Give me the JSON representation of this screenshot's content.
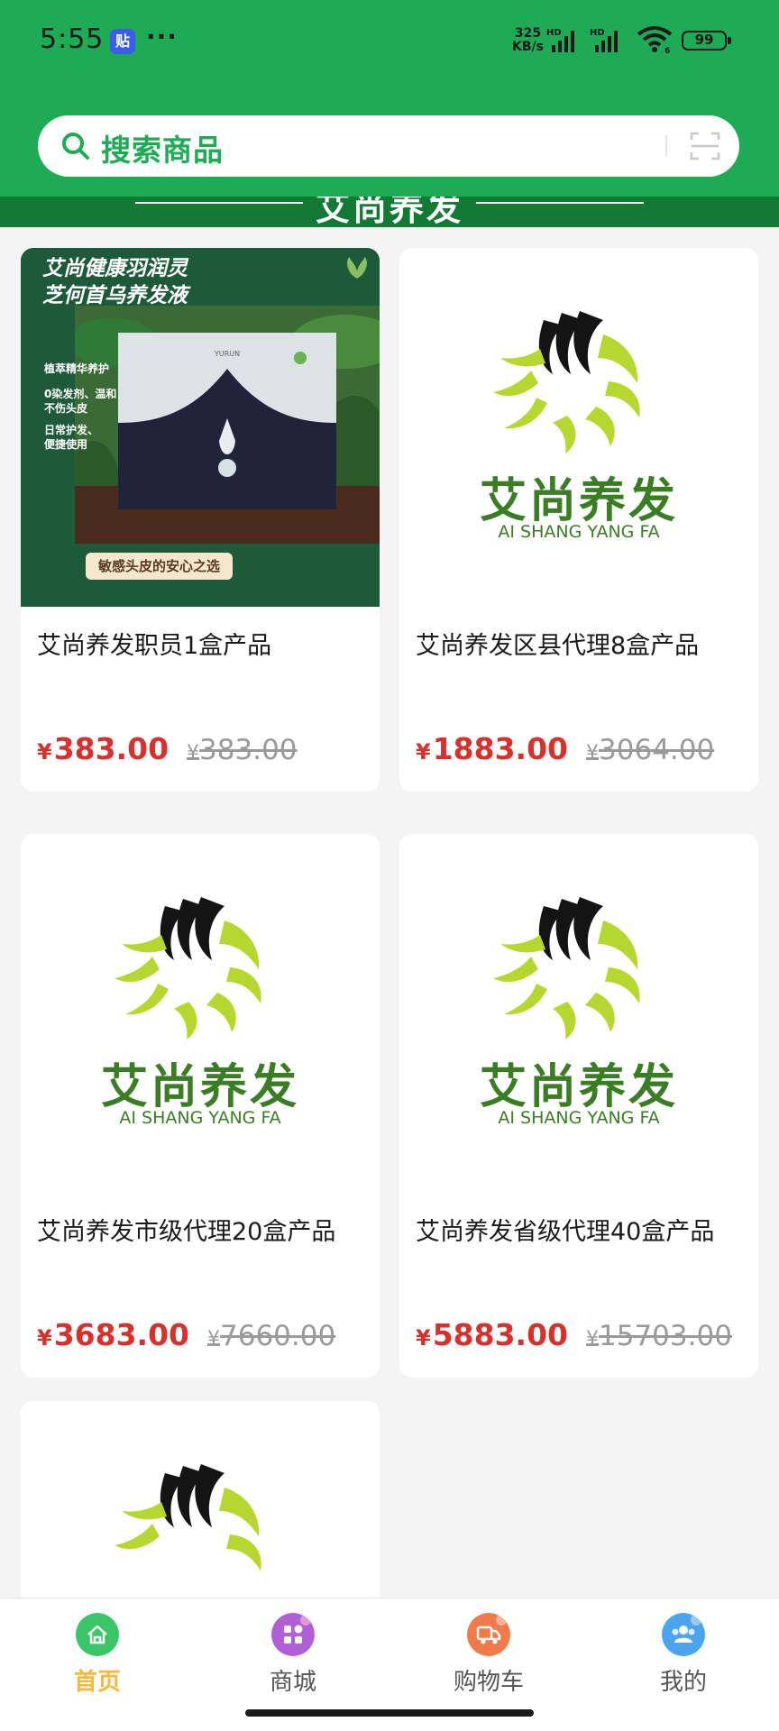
{
  "status_bar": {
    "time": "5:55",
    "app_icon": "贴",
    "more": "···",
    "net_speed_value": "325",
    "net_speed_unit": "KB/s",
    "signal_1": "HD",
    "signal_2": "HD",
    "wifi_badge": "6",
    "battery": "99"
  },
  "search": {
    "placeholder": "搜索商品",
    "icon": "search-icon",
    "scan_icon": "scan-icon"
  },
  "banner": {
    "title": "艾尚养发"
  },
  "products": [
    {
      "title": "艾尚养发职员1盒产品",
      "currency": "¥",
      "price": "383.00",
      "original_price": "383.00",
      "image": {
        "type": "photo",
        "headline_1": "艾尚健康羽润灵",
        "headline_2": "芝何首乌养发液",
        "side_1": "植萃精华养护",
        "side_2": "0染发剂、温和",
        "side_3": "不伤头皮",
        "side_4": "日常护发、",
        "side_5": "便捷使用",
        "badge": "敏感头皮的安心之选",
        "box_brand": "YURUN"
      }
    },
    {
      "title": "艾尚养发区县代理8盒产品",
      "currency": "¥",
      "price": "1883.00",
      "original_price": "3064.00",
      "image": {
        "type": "logo",
        "cn": "艾尚养发",
        "en": "AI SHANG YANG FA"
      }
    },
    {
      "title": "艾尚养发市级代理20盒产品",
      "currency": "¥",
      "price": "3683.00",
      "original_price": "7660.00",
      "image": {
        "type": "logo",
        "cn": "艾尚养发",
        "en": "AI SHANG YANG FA"
      }
    },
    {
      "title": "艾尚养发省级代理40盒产品",
      "currency": "¥",
      "price": "5883.00",
      "original_price": "15703.00",
      "image": {
        "type": "logo",
        "cn": "艾尚养发",
        "en": "AI SHANG YANG FA"
      }
    },
    {
      "title": "",
      "image": {
        "type": "logo"
      }
    }
  ],
  "bottom_nav": {
    "items": [
      {
        "label": "首页",
        "icon": "home-icon",
        "color": "#3cc46a",
        "active": true
      },
      {
        "label": "商城",
        "icon": "mall-grid-icon",
        "color": "#b15fd6",
        "active": false
      },
      {
        "label": "购物车",
        "icon": "cart-truck-icon",
        "color": "#f07a4a",
        "active": false
      },
      {
        "label": "我的",
        "icon": "user-group-icon",
        "color": "#4aa4ee",
        "active": false
      }
    ]
  },
  "colors": {
    "brand_green": "#1faa55",
    "price_red": "#d9302c",
    "active_nav": "#f2b93a",
    "logo_green": "#3a7d24",
    "logo_lime": "#b6d630"
  }
}
